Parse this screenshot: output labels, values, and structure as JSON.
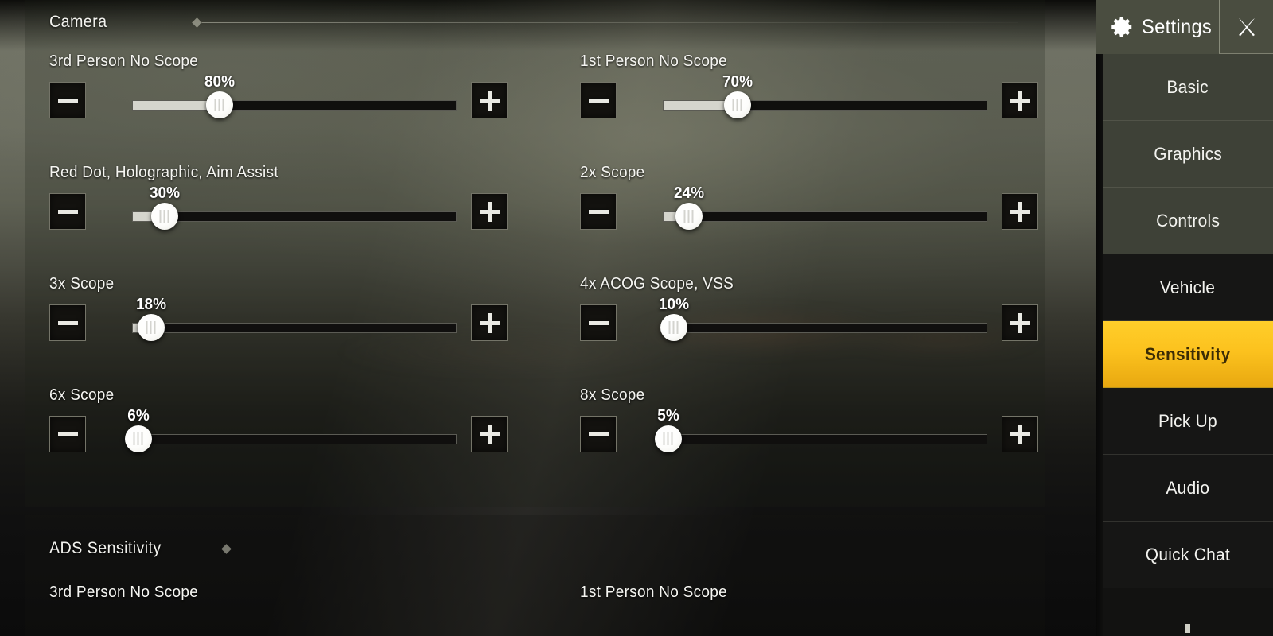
{
  "window": {
    "title": "Settings",
    "gear_icon": "gear-icon",
    "close_icon": "close-icon"
  },
  "sidebar": {
    "items": [
      {
        "label": "Basic",
        "active": false
      },
      {
        "label": "Graphics",
        "active": false
      },
      {
        "label": "Controls",
        "active": false
      },
      {
        "label": "Vehicle",
        "active": false
      },
      {
        "label": "Sensitivity",
        "active": true
      },
      {
        "label": "Pick Up",
        "active": false
      },
      {
        "label": "Audio",
        "active": false
      },
      {
        "label": "Quick Chat",
        "active": false
      }
    ],
    "active_color": "#fcc21e",
    "active_text_color": "#3b2c05"
  },
  "sections": [
    {
      "title": "Camera",
      "rows": [
        {
          "label": "3rd Person No Scope",
          "value": "80%",
          "percent": 80,
          "fill_ratio": 0.27,
          "minus": "minus-button",
          "plus": "plus-button"
        },
        {
          "label": "1st Person No Scope",
          "value": "70%",
          "percent": 70,
          "fill_ratio": 0.23,
          "minus": "minus-button",
          "plus": "plus-button"
        },
        {
          "label": "Red Dot, Holographic, Aim Assist",
          "value": "30%",
          "percent": 30,
          "fill_ratio": 0.1,
          "minus": "minus-button",
          "plus": "plus-button"
        },
        {
          "label": "2x Scope",
          "value": "24%",
          "percent": 24,
          "fill_ratio": 0.08,
          "minus": "minus-button",
          "plus": "plus-button"
        },
        {
          "label": "3x Scope",
          "value": "18%",
          "percent": 18,
          "fill_ratio": 0.06,
          "minus": "minus-button",
          "plus": "plus-button"
        },
        {
          "label": "4x ACOG Scope, VSS",
          "value": "10%",
          "percent": 10,
          "fill_ratio": 0.035,
          "minus": "minus-button",
          "plus": "plus-button"
        },
        {
          "label": "6x Scope",
          "value": "6%",
          "percent": 6,
          "fill_ratio": 0.02,
          "minus": "minus-button",
          "plus": "plus-button"
        },
        {
          "label": "8x Scope",
          "value": "5%",
          "percent": 5,
          "fill_ratio": 0.018,
          "minus": "minus-button",
          "plus": "plus-button"
        }
      ]
    },
    {
      "title": "ADS Sensitivity",
      "rows": [
        {
          "label": "3rd Person No Scope"
        },
        {
          "label": "1st Person No Scope"
        }
      ]
    }
  ]
}
